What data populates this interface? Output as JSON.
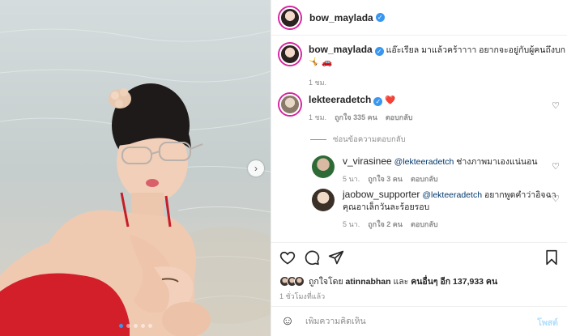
{
  "post": {
    "username": "bow_maylada",
    "more_icon": "more-horizontal-icon",
    "caption": {
      "username": "bow_maylada",
      "text": "แอ๊ะเรียล มาแล้วคร้าาาา อยากจะอยู่กับผู้คนถึงบก 🤸 🚗",
      "time": "1 ชม."
    },
    "media": {
      "next_icon": "chevron-right-icon",
      "slides_total": 5,
      "active_slide": 1
    }
  },
  "comments": [
    {
      "username": "lekteeradetch",
      "text": "❤️",
      "time": "1 ชม.",
      "likes": "ถูกใจ 335 คน",
      "reply": "ตอบกลับ"
    }
  ],
  "hide_replies": "ซ่อนข้อความตอบกลับ",
  "replies": [
    {
      "username": "v_virasinee",
      "mention": "@lekteeradetch",
      "text": "ช่างภาพมาเองแน่นอน",
      "time": "5 นา.",
      "likes": "ถูกใจ 3 คน",
      "reply": "ตอบกลับ"
    },
    {
      "username": "jaobow_supporter",
      "mention": "@lekteeradetch",
      "text": "อยากพูดคำว่าอิจฉา",
      "text2": "คุณอาเล็กวันละร้อยรอบ",
      "time": "5 นา.",
      "likes": "ถูกใจ 2 คน",
      "reply": "ตอบกลับ"
    }
  ],
  "actions": {
    "like_icon": "heart-icon",
    "comment_icon": "comment-icon",
    "share_icon": "send-icon",
    "save_icon": "bookmark-icon"
  },
  "likes": {
    "prefix": "ถูกใจโดย",
    "user": "atinnabhan",
    "middle": "และ",
    "others": "คนอื่นๆ อีก 137,933 คน"
  },
  "posted_time": "1 ชั่วโมงที่แล้ว",
  "add_comment": {
    "emoji_icon": "emoji-smile-icon",
    "placeholder": "เพิ่มความคิดเห็น",
    "post_label": "โพสต์"
  },
  "colors": {
    "link": "#00376b",
    "verified": "#3897f0",
    "heart": "#ed4956",
    "muted": "#8e8e8e"
  }
}
